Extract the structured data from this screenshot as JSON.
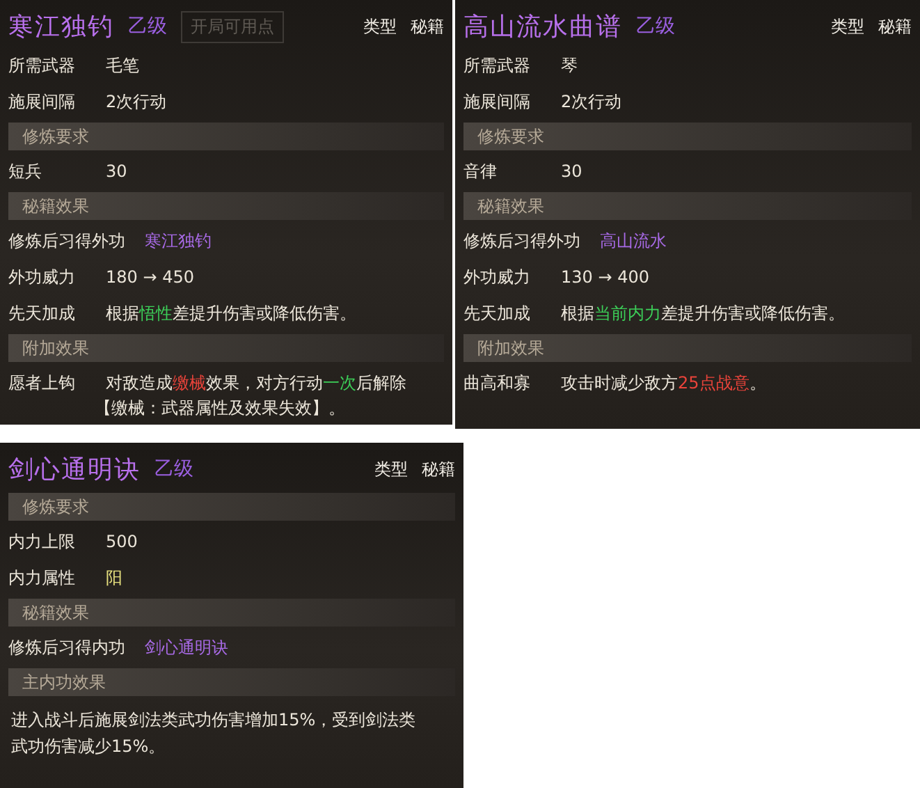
{
  "panels": [
    {
      "title": "寒江独钓",
      "grade": "乙级",
      "background_text": "开局可用点",
      "type_label": "类型",
      "type_value": "秘籍",
      "rows": [
        {
          "kind": "field",
          "label": "所需武器",
          "value": [
            {
              "text": "毛笔"
            }
          ]
        },
        {
          "kind": "field",
          "label": "施展间隔",
          "value": [
            {
              "text": "2次行动"
            }
          ]
        },
        {
          "kind": "section",
          "label": "修炼要求"
        },
        {
          "kind": "field",
          "label": "短兵",
          "value": [
            {
              "text": "30"
            }
          ]
        },
        {
          "kind": "section",
          "label": "秘籍效果"
        },
        {
          "kind": "field",
          "label": "修炼后习得外功",
          "value": [
            {
              "text": "寒江独钓",
              "color": "#a86ae6"
            }
          ]
        },
        {
          "kind": "field",
          "label": "外功威力",
          "value": [
            {
              "text": "180 → 450"
            }
          ]
        },
        {
          "kind": "field",
          "label": "先天加成",
          "value": [
            {
              "text": "根据"
            },
            {
              "text": "悟性",
              "color": "#3ccf58"
            },
            {
              "text": "差提升伤害或降低伤害。"
            }
          ]
        },
        {
          "kind": "section",
          "label": "附加效果"
        },
        {
          "kind": "field",
          "label": "愿者上钩",
          "value": [
            {
              "text": "对敌造成"
            },
            {
              "text": "缴械",
              "color": "#e8433a"
            },
            {
              "text": "效果，对方行动"
            },
            {
              "text": "一次",
              "color": "#3ccf58"
            },
            {
              "text": "后解除"
            }
          ],
          "more": [
            {
              "text": "【缴械：武器属性及效果失效】。"
            }
          ]
        }
      ]
    },
    {
      "title": "高山流水曲谱",
      "grade": "乙级",
      "type_label": "类型",
      "type_value": "秘籍",
      "rows": [
        {
          "kind": "field",
          "label": "所需武器",
          "value": [
            {
              "text": "琴"
            }
          ]
        },
        {
          "kind": "field",
          "label": "施展间隔",
          "value": [
            {
              "text": "2次行动"
            }
          ]
        },
        {
          "kind": "section",
          "label": "修炼要求"
        },
        {
          "kind": "field",
          "label": "音律",
          "value": [
            {
              "text": "30"
            }
          ]
        },
        {
          "kind": "section",
          "label": "秘籍效果"
        },
        {
          "kind": "field",
          "label": "修炼后习得外功",
          "value": [
            {
              "text": "高山流水",
              "color": "#a86ae6"
            }
          ]
        },
        {
          "kind": "field",
          "label": "外功威力",
          "value": [
            {
              "text": "130 → 400"
            }
          ]
        },
        {
          "kind": "field",
          "label": "先天加成",
          "value": [
            {
              "text": "根据"
            },
            {
              "text": "当前内力",
              "color": "#3ccf58"
            },
            {
              "text": "差提升伤害或降低伤害。"
            }
          ]
        },
        {
          "kind": "section",
          "label": "附加效果"
        },
        {
          "kind": "field",
          "label": "曲高和寡",
          "value": [
            {
              "text": "攻击时减少敌方"
            },
            {
              "text": "25点战意",
              "color": "#e8433a"
            },
            {
              "text": "。"
            }
          ]
        }
      ]
    },
    {
      "title": "剑心通明诀",
      "grade": "乙级",
      "type_label": "类型",
      "type_value": "秘籍",
      "rows": [
        {
          "kind": "section",
          "label": "修炼要求"
        },
        {
          "kind": "field",
          "label": "内力上限",
          "value": [
            {
              "text": "500"
            }
          ]
        },
        {
          "kind": "field",
          "label": "内力属性",
          "value": [
            {
              "text": "阳",
              "color": "#e6e07e"
            }
          ]
        },
        {
          "kind": "section",
          "label": "秘籍效果"
        },
        {
          "kind": "field",
          "label": "修炼后习得内功",
          "value": [
            {
              "text": "剑心通明诀",
              "color": "#a86ae6"
            }
          ]
        },
        {
          "kind": "section",
          "label": "主内功效果"
        },
        {
          "kind": "text",
          "lines": [
            "进入战斗后施展剑法类武功伤害增加15%，受到剑法类",
            "武功伤害减少15%。"
          ]
        }
      ]
    }
  ]
}
